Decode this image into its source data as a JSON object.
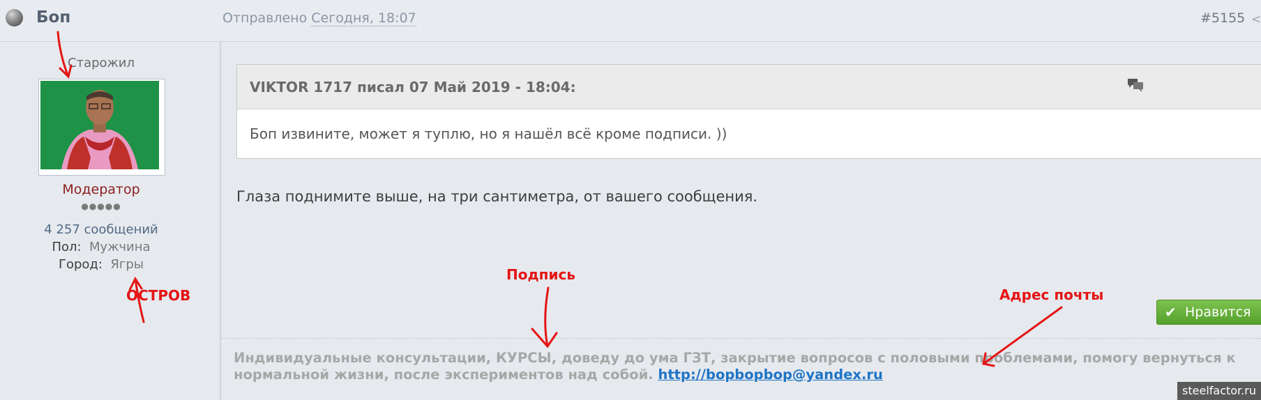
{
  "header": {
    "author": "Боп",
    "posted_prefix": "Отправлено",
    "posted_date": "Сегодня, 18:07",
    "post_number": "#5155"
  },
  "sidebar": {
    "rank": "Старожил",
    "group": "Модератор",
    "pips": "●●●●●",
    "posts": "4 257 сообщений",
    "fields": [
      {
        "label": "Пол:",
        "value": "Мужчина"
      },
      {
        "label": "Город:",
        "value": "Ягры"
      }
    ]
  },
  "quote": {
    "header": "VIKTOR 1717 писал 07 Май 2019 - 18:04:",
    "body": "Боп извините, может я туплю, но я нашёл всё кроме подписи. ))"
  },
  "post": {
    "text": "Глаза поднимите выше, на три сантиметра, от вашего сообщения."
  },
  "like_button": {
    "label": "Нравится"
  },
  "signature": {
    "text": "Индивидуальные консультации, КУРСЫ, доведу до ума ГЗТ, закрытие вопросов с половыми проблемами, помогу вернуться к нормальной жизни, после экспериментов над собой.",
    "link": "http://bopbopbop@yandex.ru"
  },
  "annotations": {
    "island": "ОСТРОВ",
    "signature": "Подпись",
    "email": "Адрес почты"
  },
  "watermark": "steelfactor.ru",
  "colors": {
    "annotation": "#e41414",
    "like_button": "#5aa82f",
    "moderator": "#8b1f1f",
    "link": "#1e74c6"
  }
}
